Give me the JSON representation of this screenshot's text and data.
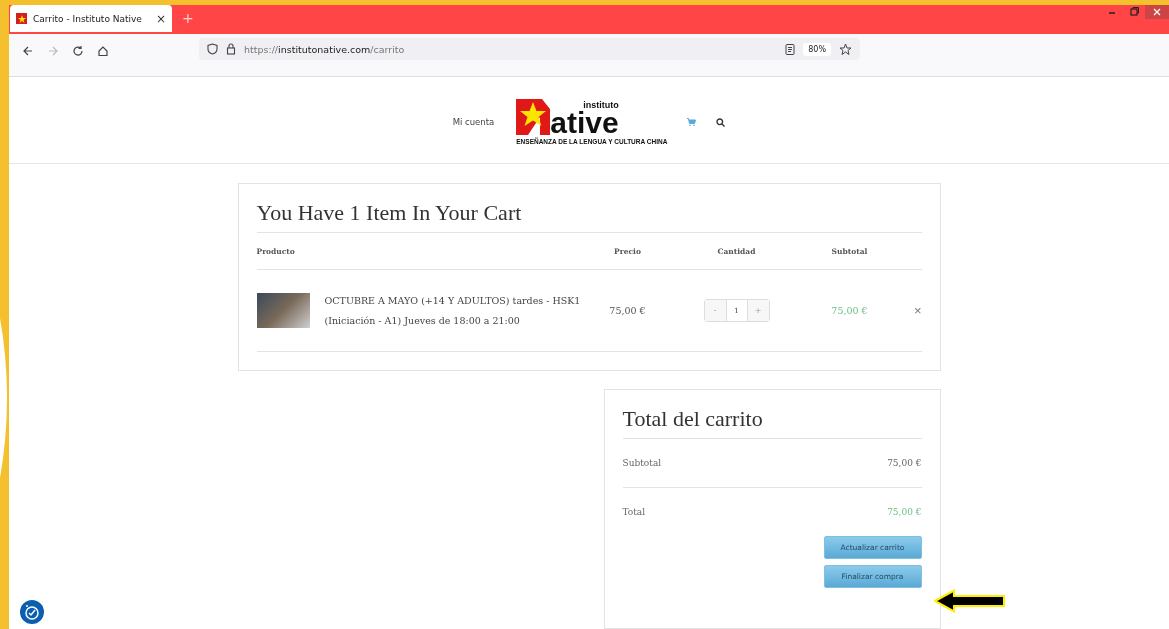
{
  "browser": {
    "tab": {
      "title": "Carrito - Instituto Native",
      "close": "×"
    },
    "new_tab": "+",
    "url": {
      "prefix": "https://",
      "domain": "institutonative.com",
      "path": "/carrito"
    },
    "zoom": "80%"
  },
  "header": {
    "account_link": "Mi cuenta",
    "logo": {
      "top": "instituto",
      "word": "ative",
      "tagline": "ENSEÑANZA DE LA LENGUA Y CULTURA CHINA"
    }
  },
  "cart": {
    "title": "You Have 1 Item In Your Cart",
    "columns": [
      "Producto",
      "Precio",
      "Cantidad",
      "Subtotal"
    ],
    "items": [
      {
        "name": "OCTUBRE A MAYO (+14 Y ADULTOS) tardes - HSK1 (Iniciación - A1) Jueves de 18:00 a 21:00",
        "price": "75,00 €",
        "decrement": "-",
        "quantity": "1",
        "increment": "+",
        "subtotal": "75,00 €",
        "remove": "×"
      }
    ]
  },
  "totals": {
    "title": "Total del carrito",
    "rows": [
      {
        "label": "Subtotal",
        "value": "75,00 €",
        "kind": "plain"
      },
      {
        "label": "Total",
        "value": "75,00 €",
        "kind": "total"
      }
    ],
    "buttons": [
      "Actualizar carrito",
      "Finalizar compra"
    ]
  }
}
